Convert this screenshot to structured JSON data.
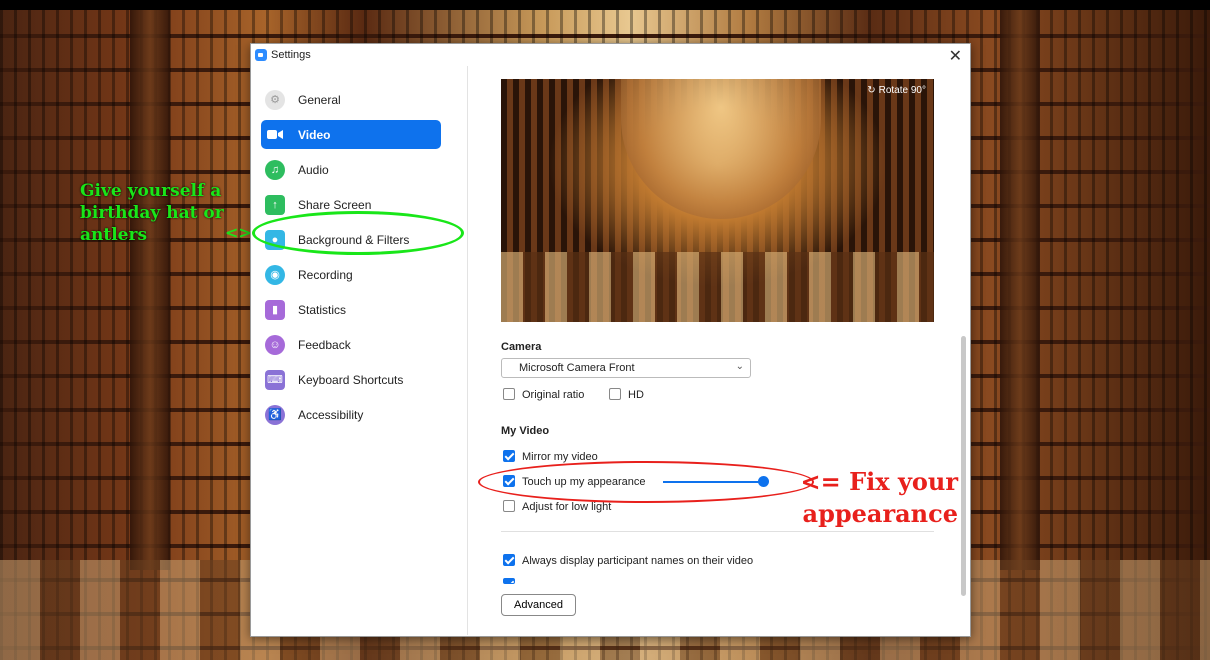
{
  "annotations": {
    "green_text": "Give yourself a birthday hat or antlers",
    "green_arrow": "<>",
    "red_arrow": "<=",
    "red_text": "Fix your appearance"
  },
  "window": {
    "title": "Settings",
    "close_icon": "close-icon"
  },
  "sidebar": {
    "items": [
      {
        "label": "General",
        "icon": "gear-icon",
        "color": "#e9e9e9"
      },
      {
        "label": "Video",
        "icon": "video-icon",
        "color": "#ffffff",
        "active": true
      },
      {
        "label": "Audio",
        "icon": "headphones-icon",
        "color": "#2ebd5f"
      },
      {
        "label": "Share Screen",
        "icon": "share-screen-icon",
        "color": "#2ebd5f"
      },
      {
        "label": "Background & Filters",
        "icon": "background-icon",
        "color": "#33b7e5"
      },
      {
        "label": "Recording",
        "icon": "recording-icon",
        "color": "#33b7e5"
      },
      {
        "label": "Statistics",
        "icon": "statistics-icon",
        "color": "#a66ad9"
      },
      {
        "label": "Feedback",
        "icon": "feedback-icon",
        "color": "#a66ad9"
      },
      {
        "label": "Keyboard Shortcuts",
        "icon": "keyboard-icon",
        "color": "#8a72d6"
      },
      {
        "label": "Accessibility",
        "icon": "accessibility-icon",
        "color": "#8a72d6"
      }
    ]
  },
  "video": {
    "rotate_label": "Rotate 90°",
    "camera_heading": "Camera",
    "camera_selected": "Microsoft Camera Front",
    "original_ratio": {
      "label": "Original ratio",
      "checked": false
    },
    "hd": {
      "label": "HD",
      "checked": false
    },
    "my_video_heading": "My Video",
    "mirror": {
      "label": "Mirror my video",
      "checked": true
    },
    "touch_up": {
      "label": "Touch up my appearance",
      "checked": true,
      "level": 1.0
    },
    "low_light": {
      "label": "Adjust for low light",
      "checked": false
    },
    "always_names": {
      "label": "Always display participant names on their video",
      "checked": true
    },
    "advanced_button": "Advanced"
  }
}
